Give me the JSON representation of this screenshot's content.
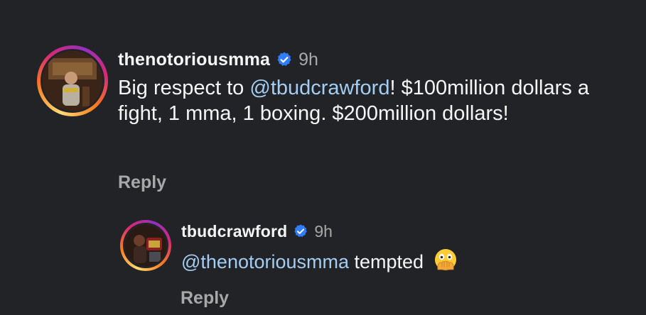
{
  "comment": {
    "username": "thenotoriousmma",
    "time": "9h",
    "text_before": "Big respect to ",
    "mention": "@tbudcrawford",
    "text_after": "! $100million dollars a fight, 1 mma, 1 boxing. $200million dollars!",
    "reply_label": "Reply",
    "avatar_icon": "profile-photo-icon",
    "verified_icon": "verified-badge-icon"
  },
  "reply": {
    "username": "tbudcrawford",
    "time": "9h",
    "mention": "@thenotoriousmma",
    "text_after": " tempted",
    "emoji_icon": "face-with-open-eyes-and-hand-over-mouth-emoji",
    "reply_label": "Reply",
    "avatar_icon": "profile-photo-icon",
    "verified_icon": "verified-badge-icon"
  },
  "colors": {
    "background": "#222326",
    "text": "#f5f5f5",
    "muted": "#a8a8a8",
    "mention": "#a3cdf2",
    "verified": "#2f7ef5"
  }
}
